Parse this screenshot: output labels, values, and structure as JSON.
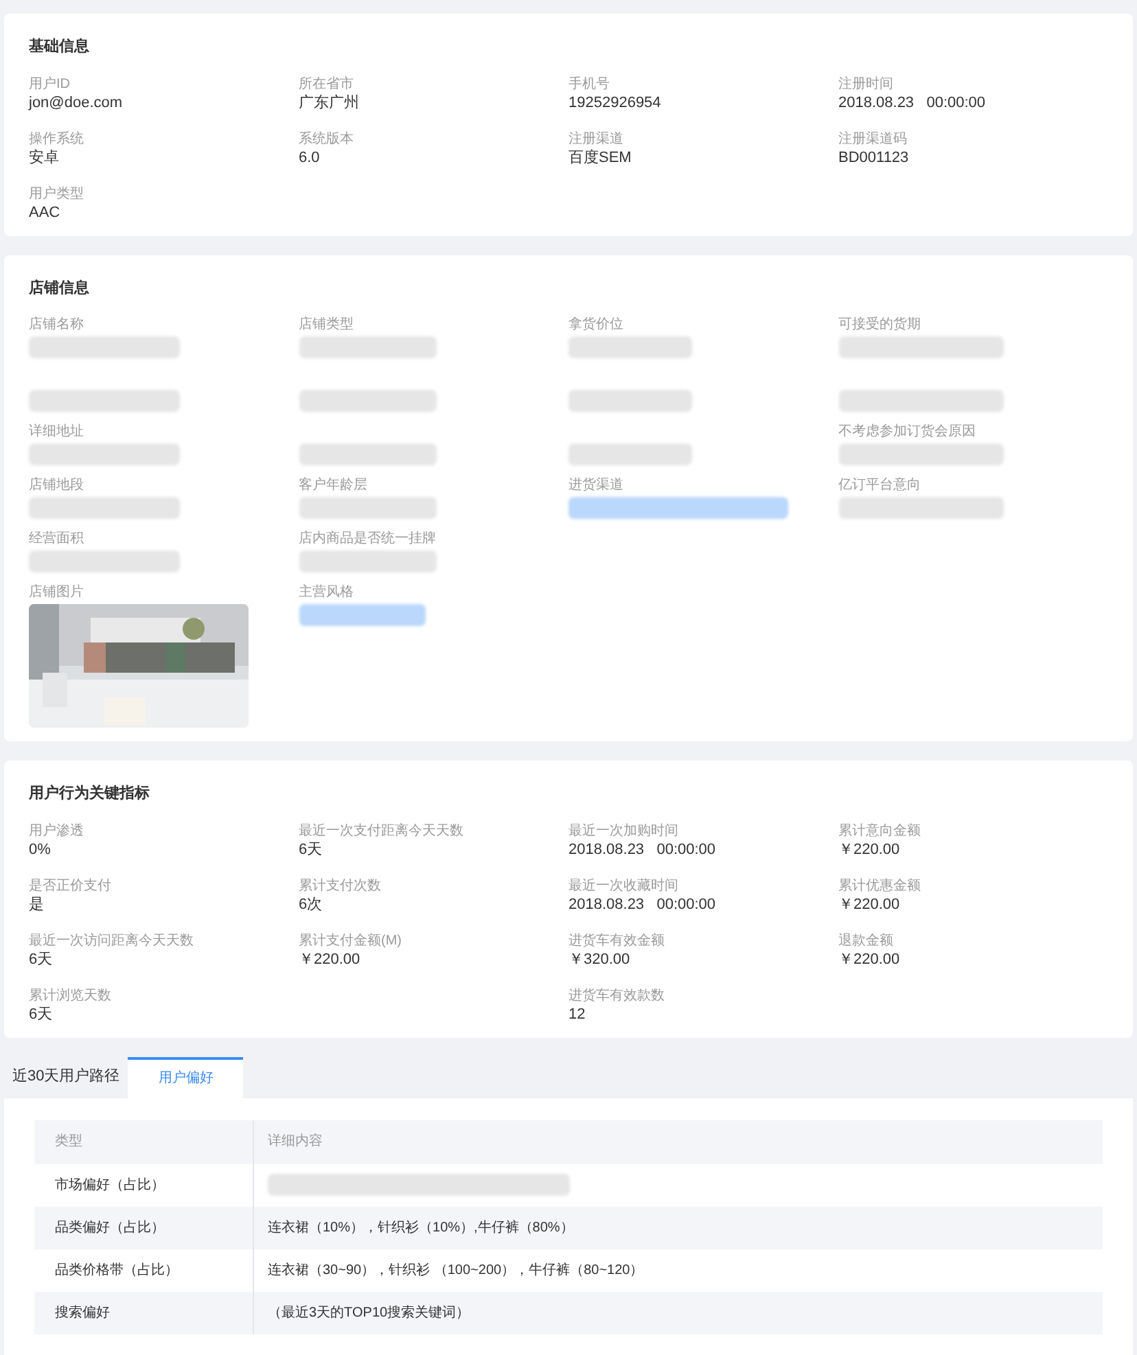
{
  "basic_info": {
    "title": "基础信息",
    "fields": [
      {
        "label": "用户ID",
        "value": "jon@doe.com"
      },
      {
        "label": "所在省市",
        "value": "广东广州"
      },
      {
        "label": "手机号",
        "value": "19252926954"
      },
      {
        "label": "注册时间",
        "value": "2018.08.23   00:00:00"
      },
      {
        "label": "操作系统",
        "value": "安卓"
      },
      {
        "label": "系统版本",
        "value": "6.0"
      },
      {
        "label": "注册渠道",
        "value": "百度SEM"
      },
      {
        "label": "注册渠道码",
        "value": "BD001123"
      },
      {
        "label": "用户类型",
        "value": "AAC"
      }
    ]
  },
  "store_info": {
    "title": "店铺信息",
    "fields": [
      {
        "label": "店铺名称",
        "kind": "blurred"
      },
      {
        "label": "店铺类型",
        "kind": "blurred"
      },
      {
        "label": "拿货价位",
        "kind": "blurred"
      },
      {
        "label": "可接受的货期",
        "kind": "blurred"
      },
      {
        "kind": "blurred"
      },
      {
        "kind": "blurred"
      },
      {
        "kind": "blurred"
      },
      {
        "kind": "blurred"
      },
      {
        "label": "详细地址",
        "kind": "blurred"
      },
      {
        "kind": "blurred"
      },
      {
        "kind": "blurred"
      },
      {
        "label": "不考虑参加订货会原因",
        "kind": "blurred"
      },
      {
        "label": "店铺地段",
        "kind": "blurred"
      },
      {
        "label": "客户年龄层",
        "kind": "blurred"
      },
      {
        "label": "进货渠道",
        "kind": "blurred_tags"
      },
      {
        "label": "亿订平台意向",
        "kind": "blurred"
      },
      {
        "label": "经营面积",
        "kind": "blurred"
      },
      {
        "label": "店内商品是否统一挂牌",
        "kind": "blurred"
      },
      {
        "kind": "empty"
      },
      {
        "kind": "empty"
      },
      {
        "label": "店铺图片",
        "kind": "picture"
      },
      {
        "label": "主营风格",
        "kind": "blurred_tags"
      }
    ]
  },
  "behavior": {
    "title": "用户行为关键指标",
    "columns": [
      [
        {
          "label": "用户渗透",
          "value": "0%"
        },
        {
          "label": "是否正价支付",
          "value": "是"
        },
        {
          "label": "最近一次访问距离今天天数",
          "value": "6天"
        },
        {
          "label": "累计浏览天数",
          "value": "6天"
        }
      ],
      [
        {
          "label": "最近一次支付距离今天天数",
          "value": "6天"
        },
        {
          "label": "累计支付次数",
          "value": "6次"
        },
        {
          "label": "累计支付金额(M)",
          "value": "￥220.00"
        }
      ],
      [
        {
          "label": "最近一次加购时间",
          "value": "2018.08.23   00:00:00"
        },
        {
          "label": "最近一次收藏时间",
          "value": "2018.08.23   00:00:00"
        },
        {
          "label": "进货车有效金额",
          "value": "￥320.00"
        },
        {
          "label": "进货车有效款数",
          "value": "12"
        }
      ],
      [
        {
          "label": "累计意向金额",
          "value": "￥220.00"
        },
        {
          "label": "累计优惠金额",
          "value": "￥220.00"
        },
        {
          "label": "退款金额",
          "value": "￥220.00"
        }
      ]
    ]
  },
  "tabs": [
    {
      "label": "近30天用户路径",
      "selected": false
    },
    {
      "label": "用户偏好",
      "selected": true
    }
  ],
  "table": {
    "columns": [
      "类型",
      "详细内容"
    ],
    "rows": [
      {
        "type": "市场偏好（占比）",
        "detail_blurred": true
      },
      {
        "type": "品类偏好（占比）",
        "detail": "连衣裙（10%），针织衫（10%）,牛仔裤（80%）"
      },
      {
        "type": "品类价格带（占比）",
        "detail": "连衣裙（30~90），针织衫 （100~200），牛仔裤（80~120）"
      },
      {
        "type": "搜索偏好",
        "detail": "（最近3天的TOP10搜索关键词）"
      }
    ]
  }
}
